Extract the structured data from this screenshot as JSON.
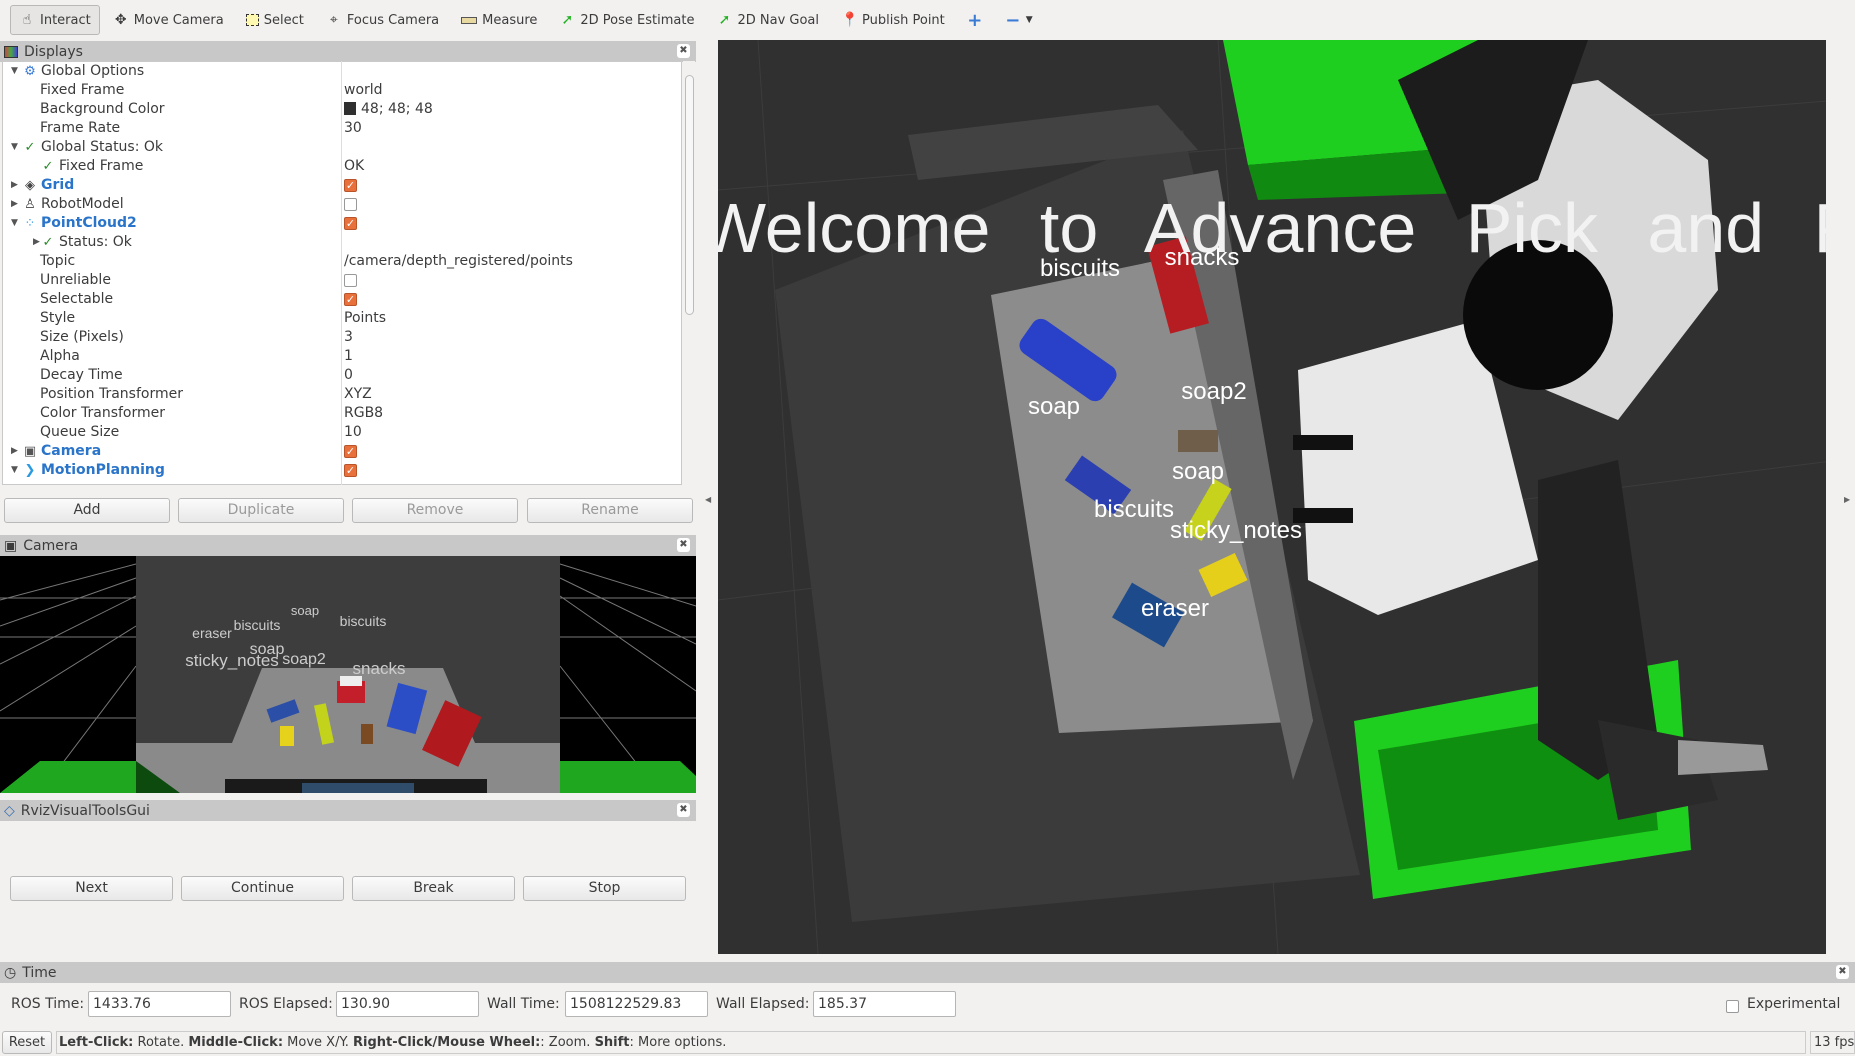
{
  "toolbar": {
    "tools": [
      {
        "label": "Interact",
        "icon": "hand-icon"
      },
      {
        "label": "Move Camera",
        "icon": "move-camera-icon"
      },
      {
        "label": "Select",
        "icon": "select-icon"
      },
      {
        "label": "Focus Camera",
        "icon": "focus-camera-icon"
      },
      {
        "label": "Measure",
        "icon": "ruler-icon"
      },
      {
        "label": "2D Pose Estimate",
        "icon": "green-arrow-icon"
      },
      {
        "label": "2D Nav Goal",
        "icon": "green-arrow-icon"
      },
      {
        "label": "Publish Point",
        "icon": "map-pin-icon"
      }
    ]
  },
  "displays": {
    "title": "Displays",
    "rows": [
      {
        "label": "Global Options",
        "indent": 0,
        "exp": "down",
        "icon": "⚙",
        "icolor": "#3a7bd5"
      },
      {
        "label": "Fixed Frame",
        "indent": 1,
        "value": "world"
      },
      {
        "label": "Background Color",
        "indent": 1,
        "value": "48; 48; 48",
        "color": "#303030"
      },
      {
        "label": "Frame Rate",
        "indent": 1,
        "value": "30"
      },
      {
        "label": "Global Status: Ok",
        "indent": 0,
        "exp": "down",
        "icon": "✓",
        "icolor": "#2a8a2a"
      },
      {
        "label": "Fixed Frame",
        "indent": 1,
        "value": "OK",
        "icon": "✓",
        "icolor": "#2a8a2a"
      },
      {
        "label": "Grid",
        "indent": 0,
        "exp": "right",
        "icon": "◈",
        "icolor": "#444",
        "blue": true,
        "check": true
      },
      {
        "label": "RobotModel",
        "indent": 0,
        "exp": "right",
        "icon": "♙",
        "icolor": "#444",
        "check": false
      },
      {
        "label": "PointCloud2",
        "indent": 0,
        "exp": "down",
        "icon": "⁘",
        "icolor": "#2a9ae0",
        "blue": true,
        "check": true
      },
      {
        "label": "Status: Ok",
        "indent": 1,
        "exp": "right",
        "icon": "✓",
        "icolor": "#2a8a2a"
      },
      {
        "label": "Topic",
        "indent": 1,
        "value": "/camera/depth_registered/points"
      },
      {
        "label": "Unreliable",
        "indent": 1,
        "check": false
      },
      {
        "label": "Selectable",
        "indent": 1,
        "check": true
      },
      {
        "label": "Style",
        "indent": 1,
        "value": "Points"
      },
      {
        "label": "Size (Pixels)",
        "indent": 1,
        "value": "3"
      },
      {
        "label": "Alpha",
        "indent": 1,
        "value": "1"
      },
      {
        "label": "Decay Time",
        "indent": 1,
        "value": "0"
      },
      {
        "label": "Position Transformer",
        "indent": 1,
        "value": "XYZ"
      },
      {
        "label": "Color Transformer",
        "indent": 1,
        "value": "RGB8"
      },
      {
        "label": "Queue Size",
        "indent": 1,
        "value": "10"
      },
      {
        "label": "Camera",
        "indent": 0,
        "exp": "right",
        "icon": "▣",
        "icolor": "#555",
        "blue": true,
        "check": true
      },
      {
        "label": "MotionPlanning",
        "indent": 0,
        "exp": "down",
        "icon": "❯",
        "icolor": "#2a9ae0",
        "blue": true,
        "check": true
      }
    ],
    "buttons": {
      "add": "Add",
      "duplicate": "Duplicate",
      "remove": "Remove",
      "rename": "Rename"
    }
  },
  "camera": {
    "title": "Camera",
    "labels": [
      "eraser",
      "biscuits",
      "soap",
      "biscuits",
      "soap",
      "sticky_notes",
      "soap2",
      "snacks"
    ]
  },
  "rviz_tools": {
    "title": "RvizVisualToolsGui",
    "buttons": {
      "next": "Next",
      "continue": "Continue",
      "break": "Break",
      "stop": "Stop"
    }
  },
  "scene": {
    "banner": "Welcome to Advance Pick and Place",
    "labels": [
      "biscuits",
      "snacks",
      "soap",
      "soap2",
      "soap",
      "biscuits",
      "sticky_notes",
      "eraser"
    ]
  },
  "time": {
    "title": "Time",
    "ros_time_label": "ROS Time:",
    "ros_time": "1433.76",
    "ros_elapsed_label": "ROS Elapsed:",
    "ros_elapsed": "130.90",
    "wall_time_label": "Wall Time:",
    "wall_time": "1508122529.83",
    "wall_elapsed_label": "Wall Elapsed:",
    "wall_elapsed": "185.37",
    "experimental": "Experimental"
  },
  "status": {
    "reset": "Reset",
    "k1": "Left-Click:",
    "t1": " Rotate. ",
    "k2": "Middle-Click:",
    "t2": " Move X/Y. ",
    "k3": "Right-Click/Mouse Wheel:",
    "t3": ": Zoom. ",
    "k4": "Shift",
    "t4": ": More options.",
    "fps": "13 fps"
  }
}
